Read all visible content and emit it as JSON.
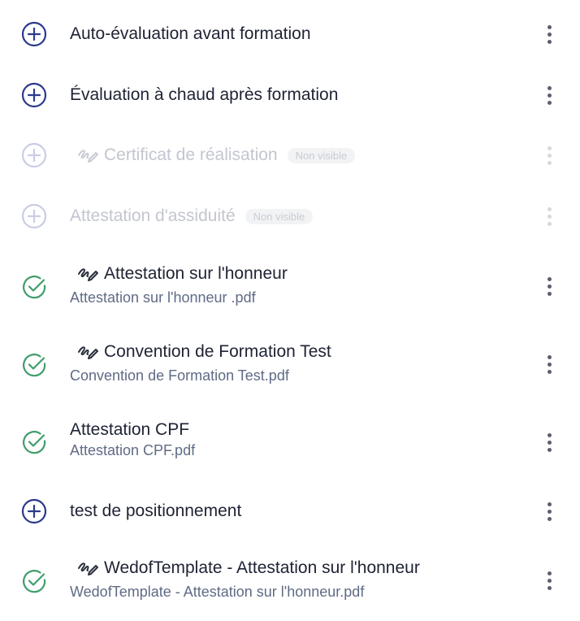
{
  "items": [
    {
      "title": "Auto-évaluation avant formation",
      "file": "",
      "state": "add",
      "signed": false,
      "muted": false,
      "badge": ""
    },
    {
      "title": "Évaluation à chaud après formation",
      "file": "",
      "state": "add",
      "signed": false,
      "muted": false,
      "badge": ""
    },
    {
      "title": "Certificat de réalisation",
      "file": "",
      "state": "add",
      "signed": true,
      "muted": true,
      "badge": "Non visible"
    },
    {
      "title": "Attestation d'assiduité",
      "file": "",
      "state": "add",
      "signed": false,
      "muted": true,
      "badge": "Non visible"
    },
    {
      "title": "Attestation sur l'honneur",
      "file": "Attestation sur l'honneur .pdf",
      "state": "done",
      "signed": true,
      "muted": false,
      "badge": ""
    },
    {
      "title": "Convention de Formation Test",
      "file": "Convention de Formation Test.pdf",
      "state": "done",
      "signed": true,
      "muted": false,
      "badge": ""
    },
    {
      "title": "Attestation CPF",
      "file": "Attestation CPF.pdf",
      "state": "done",
      "signed": false,
      "muted": false,
      "badge": ""
    },
    {
      "title": "test de positionnement",
      "file": "",
      "state": "add",
      "signed": false,
      "muted": false,
      "badge": ""
    },
    {
      "title": "WedofTemplate - Attestation sur l'honneur",
      "file": "WedofTemplate - Attestation sur l'honneur.pdf",
      "state": "done",
      "signed": true,
      "muted": false,
      "badge": ""
    }
  ],
  "icons": {
    "add": "plus-circle-icon",
    "done": "check-circle-icon",
    "signed": "signature-pen-icon",
    "menu": "more-vertical-icon"
  },
  "colors": {
    "add": "#2b3a8c",
    "add_muted": "#c9cde6",
    "done": "#3f9d6b",
    "text": "#1e2233",
    "file": "#5f6b85"
  }
}
